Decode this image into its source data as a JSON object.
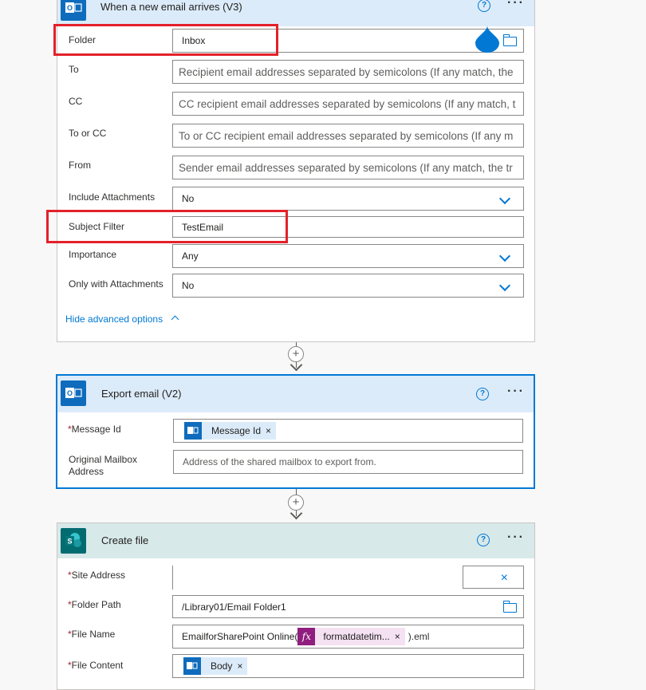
{
  "trigger": {
    "title": "When a new email arrives (V3)",
    "fields": {
      "folder": {
        "label": "Folder",
        "value": "Inbox"
      },
      "to": {
        "label": "To",
        "placeholder": "Recipient email addresses separated by semicolons (If any match, the"
      },
      "cc": {
        "label": "CC",
        "placeholder": "CC recipient email addresses separated by semicolons (If any match, t"
      },
      "to_or_cc": {
        "label": "To or CC",
        "placeholder": "To or CC recipient email addresses separated by semicolons (If any m"
      },
      "from": {
        "label": "From",
        "placeholder": "Sender email addresses separated by semicolons (If any match, the tr"
      },
      "include_attachments": {
        "label": "Include Attachments",
        "value": "No"
      },
      "subject_filter": {
        "label": "Subject Filter",
        "value": "TestEmail"
      },
      "importance": {
        "label": "Importance",
        "value": "Any"
      },
      "only_with_attachments": {
        "label": "Only with Attachments",
        "value": "No"
      }
    },
    "advanced_link": "Hide advanced options"
  },
  "export": {
    "title": "Export email (V2)",
    "message_id": {
      "label": "Message Id",
      "token": "Message Id"
    },
    "mailbox": {
      "label_line1": "Original Mailbox",
      "label_line2": "Address",
      "placeholder": "Address of the shared mailbox to export from."
    }
  },
  "create": {
    "title": "Create file",
    "site_address": {
      "label": "Site Address",
      "value": ""
    },
    "folder_path": {
      "label": "Folder Path",
      "value": "/Library01/Email Folder1"
    },
    "file_name": {
      "label": "File Name",
      "prefix": "EmailforSharePoint Online(",
      "token": "formatdatetim...",
      "suffix": ").eml"
    },
    "file_content": {
      "label": "File Content",
      "token": "Body"
    }
  },
  "common": {
    "required_mark": "*",
    "help_glyph": "?",
    "more_glyph": "···",
    "token_close": "×",
    "fx_glyph": "fx",
    "plus_glyph": "+"
  },
  "colors": {
    "accent": "#0078d4",
    "highlight": "#e3212a",
    "outlook": "#0f6cbd",
    "sharepoint": "#036c70"
  }
}
